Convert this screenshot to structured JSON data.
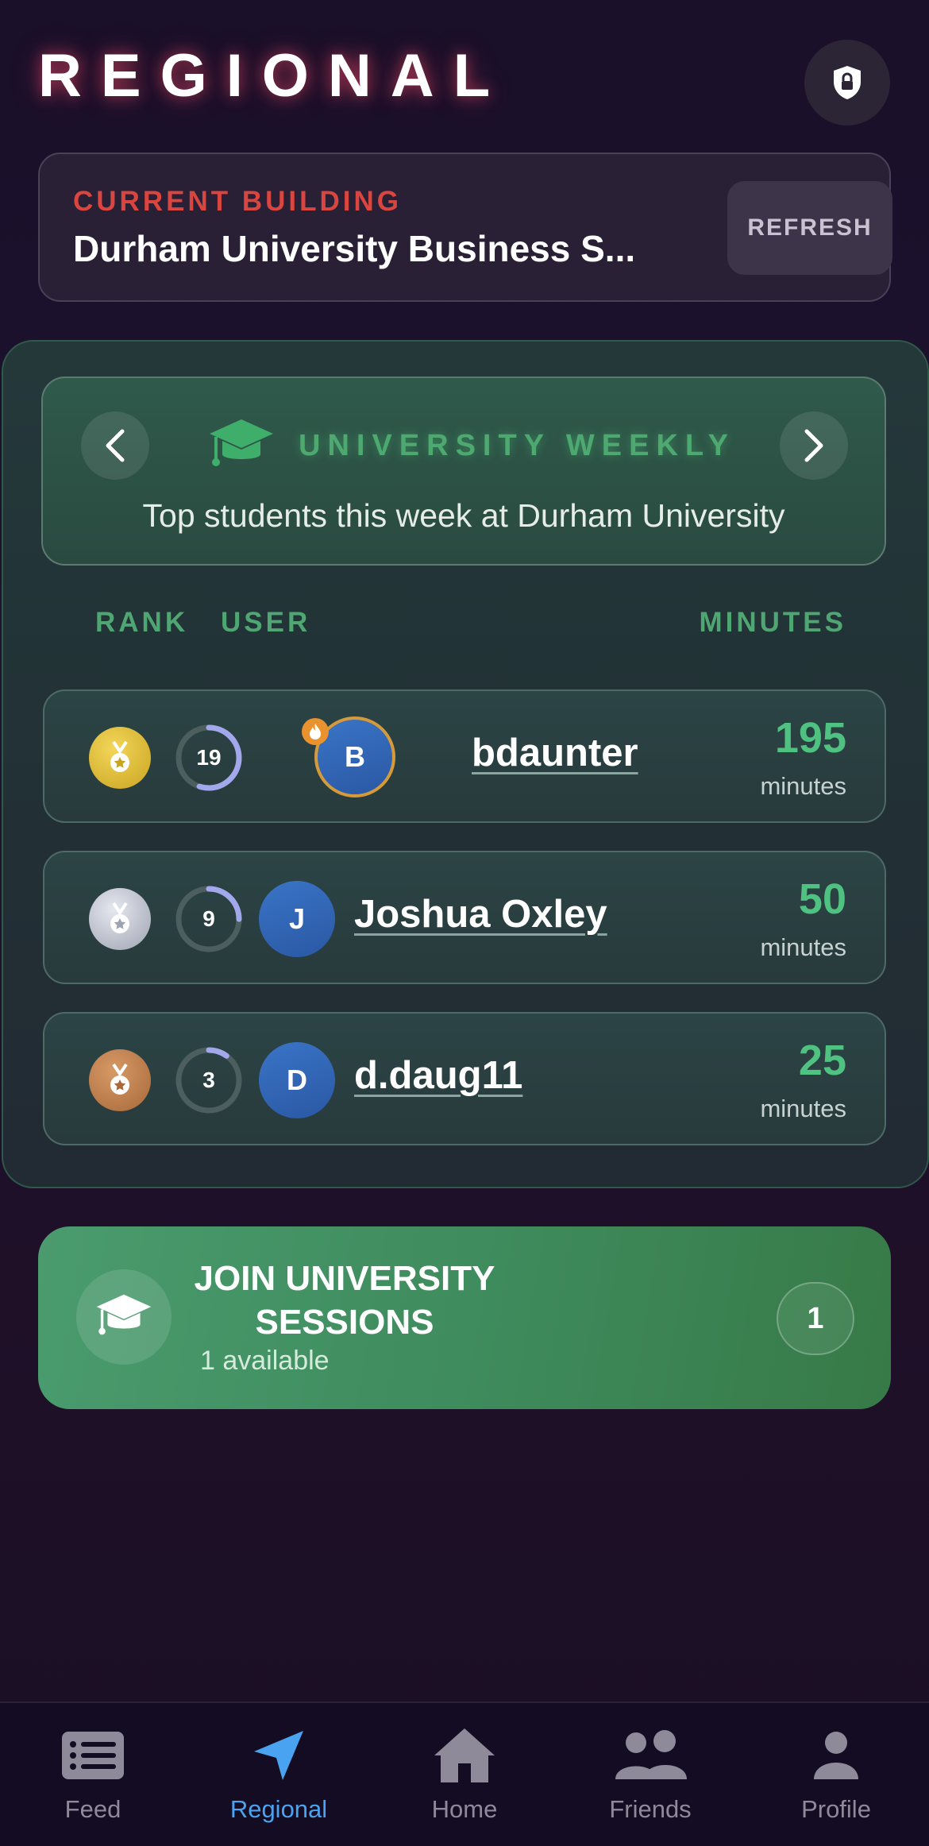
{
  "header": {
    "title": "REGIONAL",
    "lock_icon": "lock-shield-icon"
  },
  "building": {
    "label": "CURRENT BUILDING",
    "name": "Durham University Business S...",
    "refresh_label": "REFRESH"
  },
  "leaderboard": {
    "title": "UNIVERSITY WEEKLY",
    "subtitle": "Top students this week at Durham University",
    "columns": {
      "rank": "RANK",
      "user": "USER",
      "minutes": "MINUTES"
    },
    "rows": [
      {
        "medal": "gold",
        "level": "19",
        "level_progress": 0.55,
        "initial": "B",
        "name": "bdaunter",
        "minutes": "195",
        "minutes_label": "minutes",
        "streak": true
      },
      {
        "medal": "silver",
        "level": "9",
        "level_progress": 0.25,
        "initial": "J",
        "name": "Joshua Oxley",
        "minutes": "50",
        "minutes_label": "minutes",
        "streak": false
      },
      {
        "medal": "bronze",
        "level": "3",
        "level_progress": 0.1,
        "initial": "D",
        "name": "d.daug11",
        "minutes": "25",
        "minutes_label": "minutes",
        "streak": false
      }
    ]
  },
  "join": {
    "title": "JOIN UNIVERSITY SESSIONS",
    "subtitle": "1 available",
    "count": "1"
  },
  "tabs": [
    {
      "label": "Feed",
      "icon": "feed-icon",
      "active": false
    },
    {
      "label": "Regional",
      "icon": "location-arrow-icon",
      "active": true
    },
    {
      "label": "Home",
      "icon": "home-icon",
      "active": false
    },
    {
      "label": "Friends",
      "icon": "friends-icon",
      "active": false
    },
    {
      "label": "Profile",
      "icon": "profile-icon",
      "active": false
    }
  ],
  "colors": {
    "accent_green": "#4fc281",
    "accent_red": "#d9453f",
    "active_tab": "#4aa3f0"
  }
}
